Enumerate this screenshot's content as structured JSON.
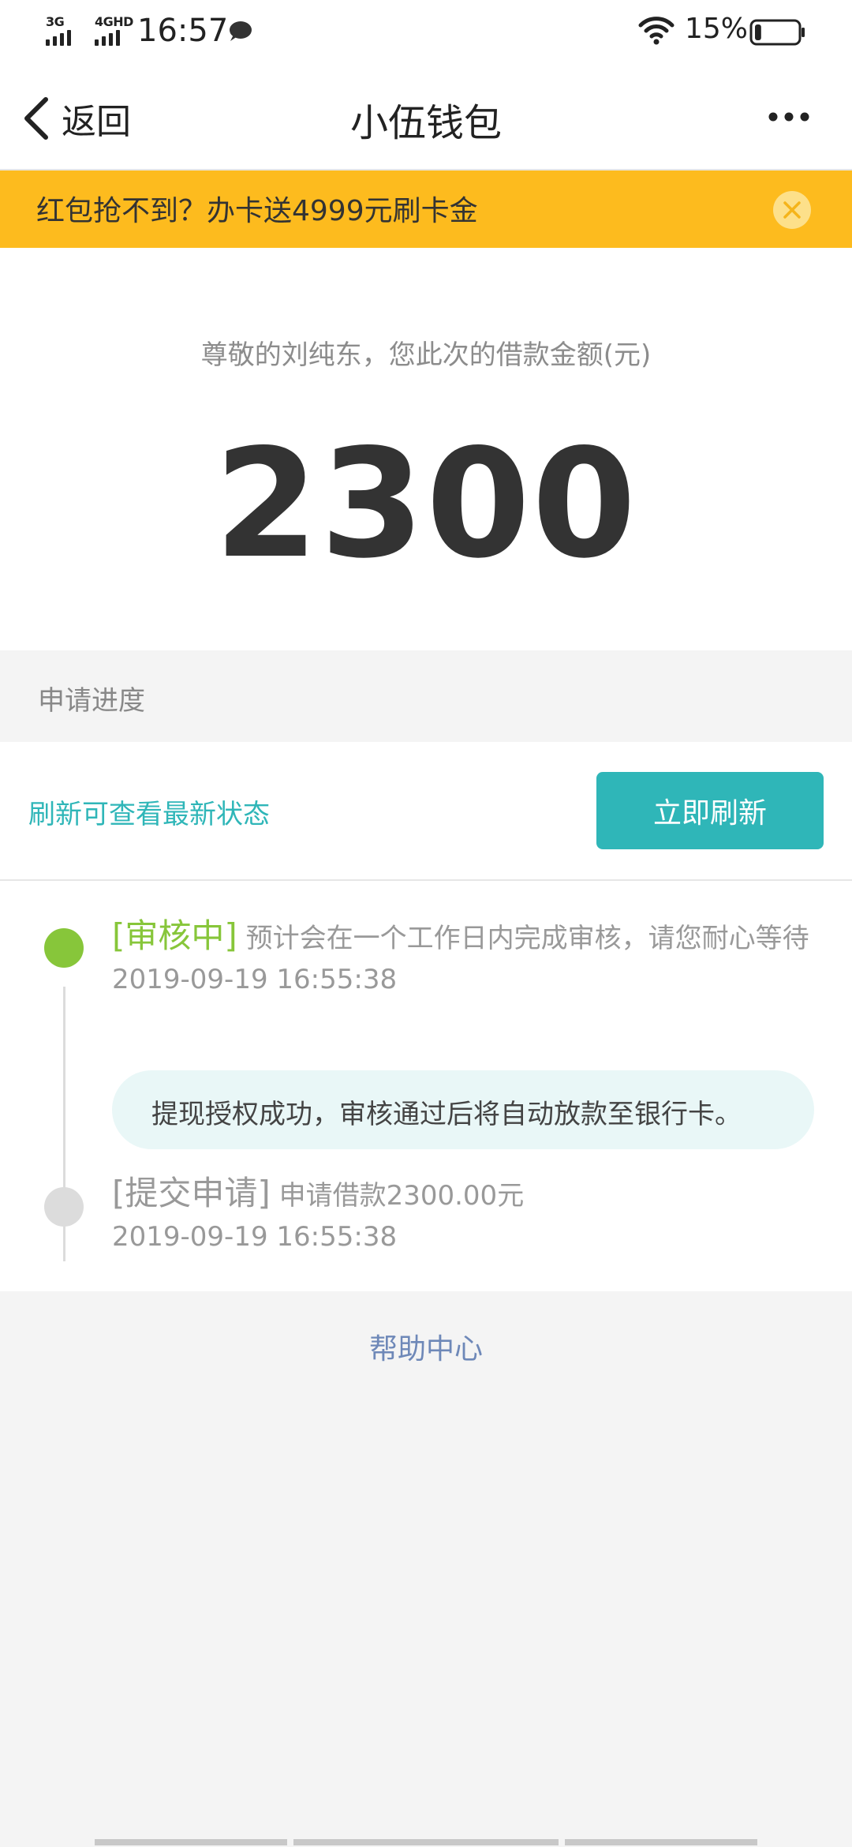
{
  "status_bar": {
    "network_1": "3G",
    "network_2": "4GHD",
    "time": "16:57",
    "battery_percent": "15%",
    "battery_level": 0.15
  },
  "header": {
    "back_label": "返回",
    "title": "小伍钱包"
  },
  "banner": {
    "text": "红包抢不到？办卡送4999元刷卡金"
  },
  "amount": {
    "label": "尊敬的刘纯东，您此次的借款金额(元)",
    "value": "2300"
  },
  "progress": {
    "section_title": "申请进度",
    "refresh_hint": "刷新可查看最新状态",
    "refresh_button": "立即刷新",
    "steps": [
      {
        "status": "[审核中]",
        "description": "预计会在一个工作日内完成审核，请您耐心等待",
        "time": "2019-09-19 16:55:38",
        "note": "提现授权成功，审核通过后将自动放款至银行卡。"
      },
      {
        "status": "[提交申请]",
        "description": "申请借款2300.00元",
        "time": "2019-09-19 16:55:38"
      }
    ]
  },
  "footer": {
    "help_link": "帮助中心"
  },
  "colors": {
    "banner_bg": "#fdbb1e",
    "accent_teal": "#2fb6b8",
    "active_green": "#87c63a",
    "link_blue": "#6e88b8"
  }
}
